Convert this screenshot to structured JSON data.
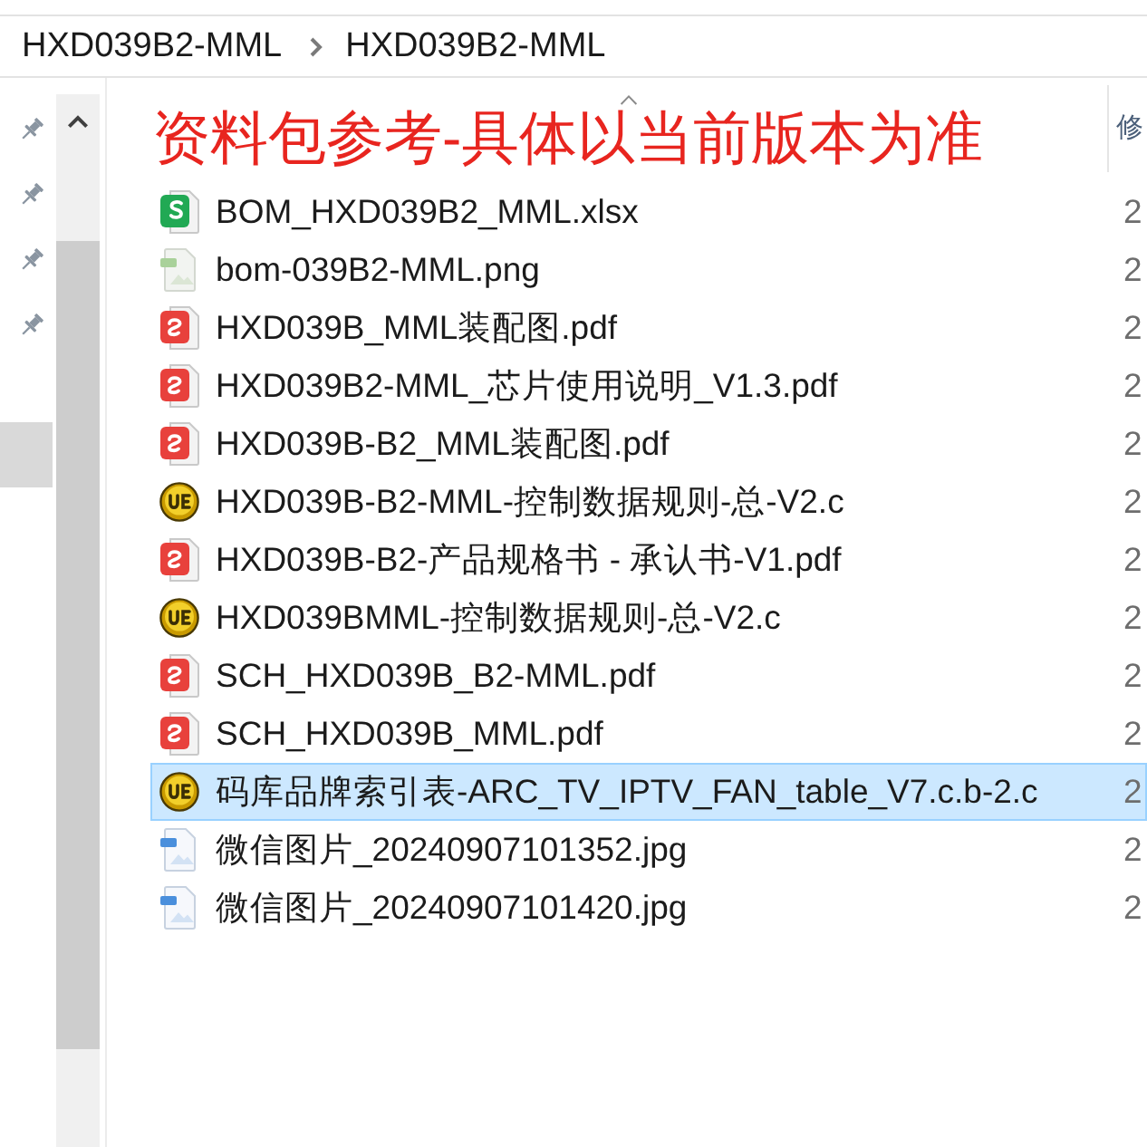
{
  "breadcrumb": [
    {
      "label": "HXD039B2-MML"
    },
    {
      "label": "HXD039B2-MML"
    }
  ],
  "nav_groups": [
    {
      "items": [
        {
          "pinned": true,
          "selected": false
        },
        {
          "pinned": true,
          "selected": false
        },
        {
          "pinned": true,
          "selected": false
        },
        {
          "pinned": true,
          "selected": false
        }
      ]
    },
    {
      "items": [
        {
          "pinned": false,
          "selected": true
        }
      ]
    }
  ],
  "columns": [
    {
      "sorted": true
    },
    {
      "label": "修",
      "sorted": false
    }
  ],
  "annotation": "资料包参考-具体以当前版本为准",
  "files": [
    {
      "name": "BOM_HXD039B2_MML.xlsx",
      "kind": "spreadsheet",
      "date": "2",
      "selected": false
    },
    {
      "name": "bom-039B2-MML.png",
      "kind": "png",
      "date": "2",
      "selected": false
    },
    {
      "name": "HXD039B_MML装配图.pdf",
      "kind": "pdf",
      "date": "2",
      "selected": false
    },
    {
      "name": "HXD039B2-MML_芯片使用说明_V1.3.pdf",
      "kind": "pdf",
      "date": "2",
      "selected": false
    },
    {
      "name": "HXD039B-B2_MML装配图.pdf",
      "kind": "pdf",
      "date": "2",
      "selected": false
    },
    {
      "name": "HXD039B-B2-MML-控制数据规则-总-V2.c",
      "kind": "code",
      "date": "2",
      "selected": false
    },
    {
      "name": "HXD039B-B2-产品规格书 - 承认书-V1.pdf",
      "kind": "pdf",
      "date": "2",
      "selected": false
    },
    {
      "name": "HXD039BMML-控制数据规则-总-V2.c",
      "kind": "code",
      "date": "2",
      "selected": false
    },
    {
      "name": "SCH_HXD039B_B2-MML.pdf",
      "kind": "pdf",
      "date": "2",
      "selected": false
    },
    {
      "name": "SCH_HXD039B_MML.pdf",
      "kind": "pdf",
      "date": "2",
      "selected": false
    },
    {
      "name": "码库品牌索引表-ARC_TV_IPTV_FAN_table_V7.c.b-2.c",
      "kind": "code",
      "date": "2",
      "selected": true
    },
    {
      "name": "微信图片_20240907101352.jpg",
      "kind": "jpg",
      "date": "2",
      "selected": false
    },
    {
      "name": "微信图片_20240907101420.jpg",
      "kind": "jpg",
      "date": "2",
      "selected": false
    }
  ]
}
